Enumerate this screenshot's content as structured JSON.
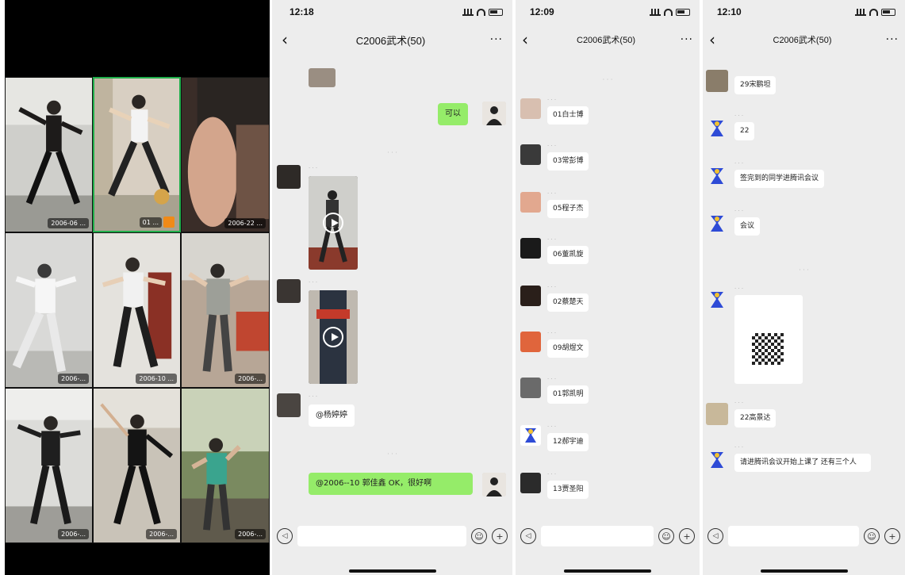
{
  "call": {
    "tiles": [
      {
        "name": "2006-06 ..."
      },
      {
        "name": "01 ..."
      },
      {
        "name": "2006-22 ..."
      },
      {
        "name": "2006-... "
      },
      {
        "name": "2006-10 ..."
      },
      {
        "name": "2006-..."
      },
      {
        "name": "2006-..."
      },
      {
        "name": "2006-..."
      },
      {
        "name": "2006-..."
      }
    ]
  },
  "panel1": {
    "status_time": "12:18",
    "title": "C2006武术(50)",
    "messages": {
      "me_1": "可以",
      "mention": "@杨婷婷",
      "me_2": "@2006--10 郭佳鑫 OK，很好啊"
    },
    "input": {
      "voice": "◁",
      "emoji": "☺",
      "plus": "+"
    }
  },
  "panel2": {
    "status_time": "12:09",
    "title": "C2006武术(50)",
    "messages": [
      "01白士博",
      "03常彭博",
      "05程子杰",
      "06董凯旋",
      "02蔡楚天",
      "09胡煜文",
      "01郭凯明",
      "12郝宇迪",
      "13贾圣阳"
    ],
    "input": {
      "voice": "◁",
      "emoji": "☺",
      "plus": "+"
    }
  },
  "panel3": {
    "status_time": "12:10",
    "title": "C2006武术(50)",
    "messages": {
      "m1": "29宋鹏坦",
      "m2": "22",
      "m3": "签完到的同学进腾讯会议",
      "m4": "会议",
      "m5": "22高景达",
      "m6": "请进腾讯会议开始上课了 还有三个人"
    },
    "input": {
      "voice": "◁",
      "emoji": "☺",
      "plus": "+"
    }
  },
  "colors": {
    "chat_bg": "#ededed",
    "bubble_me": "#95ec69",
    "bubble_other": "#ffffff",
    "active_speaker": "#1fae4a"
  }
}
